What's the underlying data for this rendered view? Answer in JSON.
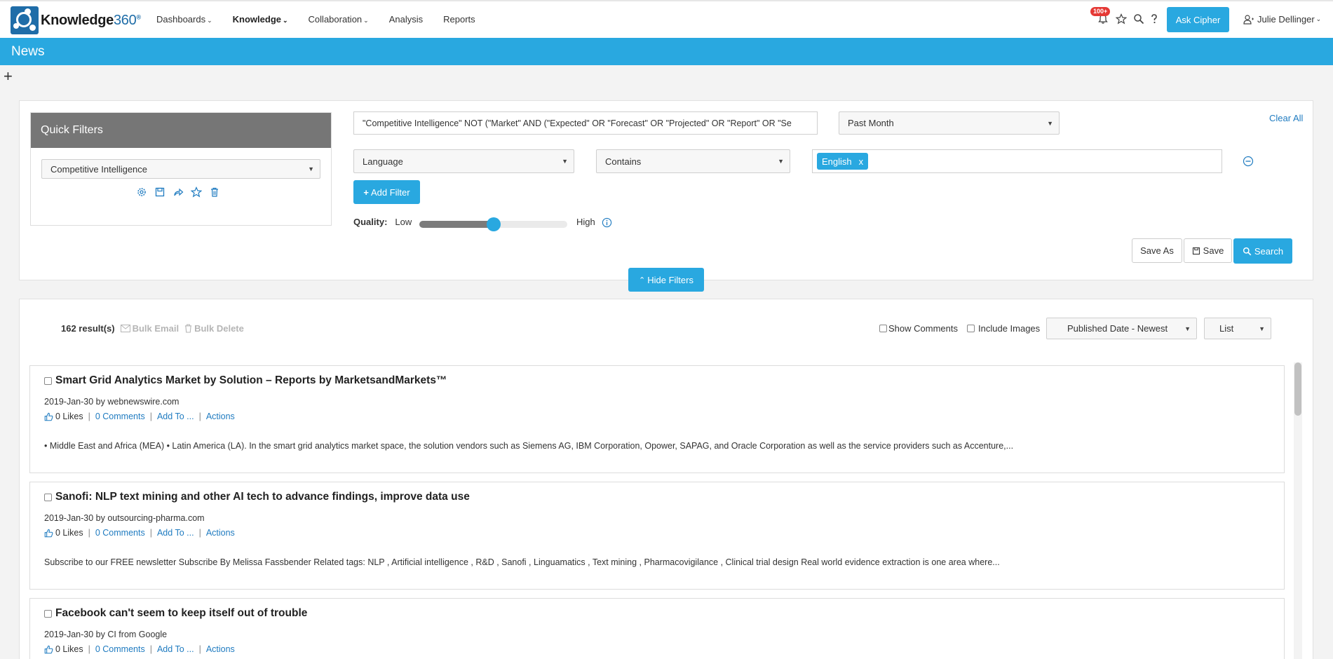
{
  "app": {
    "logo_text": "Knowledge",
    "logo_number": "360",
    "logo_mark": "®"
  },
  "nav": [
    {
      "label": "Dashboards",
      "has_dropdown": true
    },
    {
      "label": "Knowledge",
      "has_dropdown": true,
      "active": true
    },
    {
      "label": "Collaboration",
      "has_dropdown": true
    },
    {
      "label": "Analysis",
      "has_dropdown": false
    },
    {
      "label": "Reports",
      "has_dropdown": false
    }
  ],
  "topbar": {
    "notification_badge": "100+",
    "ask_button": "Ask Cipher",
    "user_name": "Julie Dellinger",
    "icons": [
      "bell-icon",
      "star-icon",
      "search-icon",
      "help-icon",
      "user-icon"
    ]
  },
  "page": {
    "title": "News"
  },
  "filters": {
    "quick_filters_title": "Quick Filters",
    "quick_filter_selected": "Competitive Intelligence",
    "query": "\"Competitive Intelligence\" NOT (\"Market\" AND (\"Expected\" OR \"Forecast\" OR \"Projected\" OR \"Report\" OR \"Se",
    "date_range": "Past Month",
    "clear_all": "Clear All",
    "field": "Language",
    "operator": "Contains",
    "tag_value": "English",
    "tag_remove": "x",
    "add_filter": "Add Filter",
    "quality_label": "Quality:",
    "quality_low": "Low",
    "quality_high": "High",
    "quality_level": 0.5,
    "save_as": "Save As",
    "save": "Save",
    "search": "Search",
    "hide_filters": "Hide Filters"
  },
  "results": {
    "count": "162 result(s)",
    "bulk_email": "Bulk Email",
    "bulk_delete": "Bulk Delete",
    "show_comments": "Show Comments",
    "include_images": "Include Images",
    "sort": "Published Date - Newest",
    "view": "List"
  },
  "articles": [
    {
      "title": "Smart Grid Analytics Market by Solution – Reports by MarketsandMarkets™",
      "meta": "2019-Jan-30 by webnewswire.com",
      "likes": "0 Likes",
      "comments": "0 Comments",
      "add_to": "Add To ...",
      "actions": "Actions",
      "snippet": "• Middle East and Africa (MEA) • Latin America (LA). In the smart grid analytics market space, the solution vendors such as Siemens AG, IBM Corporation, Opower, SAPAG, and Oracle Corporation as well as the service providers such as Accenture,..."
    },
    {
      "title": "Sanofi: NLP text mining and other AI tech to advance findings, improve data use",
      "meta": "2019-Jan-30 by outsourcing-pharma.com",
      "likes": "0 Likes",
      "comments": "0 Comments",
      "add_to": "Add To ...",
      "actions": "Actions",
      "snippet": "Subscribe to our FREE newsletter Subscribe By Melissa Fassbender Related tags: NLP , Artificial intelligence , R&D , Sanofi , Linguamatics , Text mining , Pharmacovigilance , Clinical trial design Real world evidence extraction is one area where..."
    },
    {
      "title": "Facebook can't seem to keep itself out of trouble",
      "meta": "2019-Jan-30 by CI from Google",
      "likes": "0 Likes",
      "comments": "0 Comments",
      "add_to": "Add To ...",
      "actions": "Actions",
      "snippet": ""
    }
  ]
}
